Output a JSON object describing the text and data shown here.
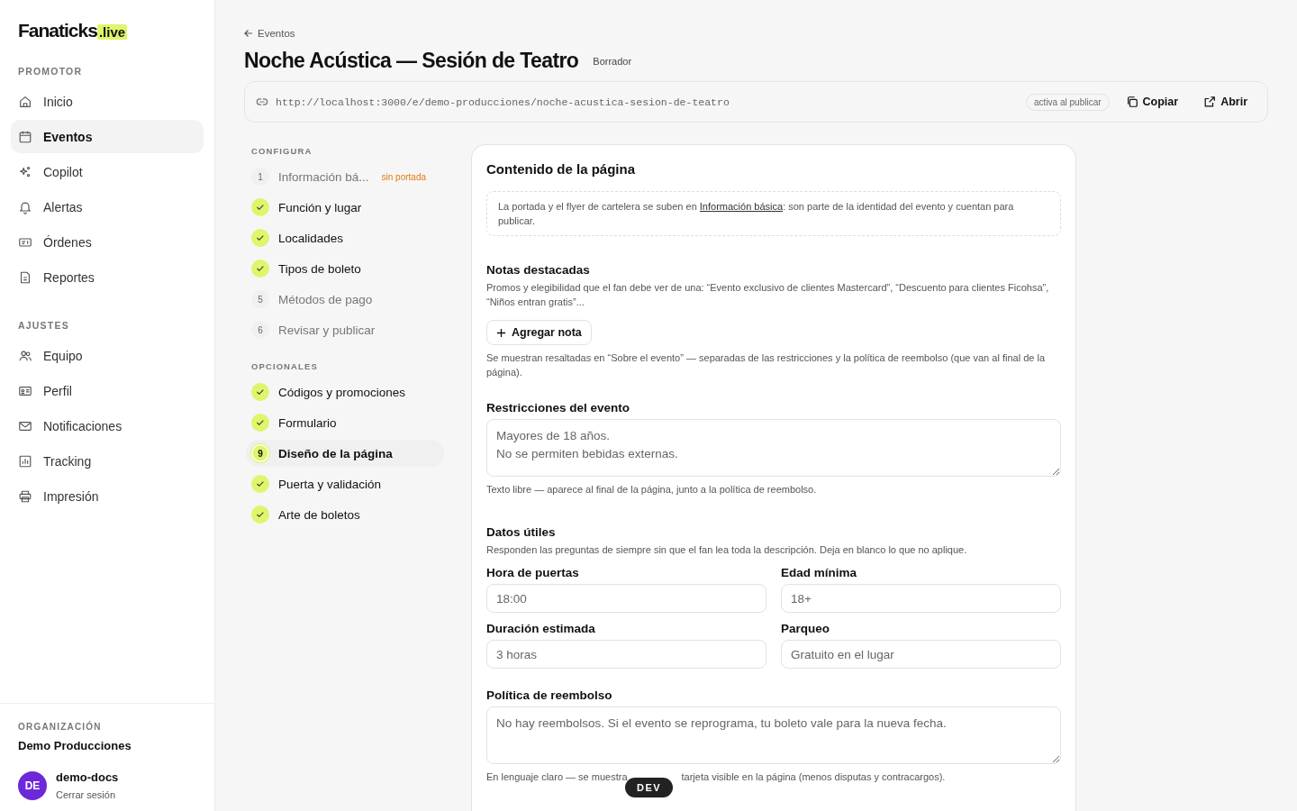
{
  "brand": {
    "name": "Fanaticks",
    "suffix": ".live"
  },
  "sidebar": {
    "sections": [
      {
        "title": "PROMOTOR",
        "items": [
          {
            "label": "Inicio",
            "selected": false
          },
          {
            "label": "Eventos",
            "selected": true
          },
          {
            "label": "Copilot",
            "selected": false
          },
          {
            "label": "Alertas",
            "selected": false
          },
          {
            "label": "Órdenes",
            "selected": false
          },
          {
            "label": "Reportes",
            "selected": false
          }
        ]
      },
      {
        "title": "AJUSTES",
        "items": [
          {
            "label": "Equipo",
            "selected": false
          },
          {
            "label": "Perfil",
            "selected": false
          },
          {
            "label": "Notificaciones",
            "selected": false
          },
          {
            "label": "Tracking",
            "selected": false
          },
          {
            "label": "Impresión",
            "selected": false
          }
        ]
      }
    ],
    "org_label": "ORGANIZACIÓN",
    "org_name": "Demo Producciones",
    "user": {
      "initials": "DE",
      "name": "demo-docs",
      "action": "Cerrar sesión"
    }
  },
  "header": {
    "back": "Eventos",
    "title": "Noche Acústica — Sesión de Teatro",
    "status": "Borrador",
    "url": "http://localhost:3000/e/demo-producciones/noche-acustica-sesion-de-teatro",
    "url_badge": "activa al publicar",
    "copy": "Copiar",
    "open": "Abrir"
  },
  "steps": [
    {
      "title": "CONFIGURA",
      "items": [
        {
          "number": "1",
          "label": "Información bá...",
          "done": false,
          "selected": false,
          "badge": "sin portada"
        },
        {
          "label": "Función y lugar",
          "done": true,
          "selected": false
        },
        {
          "label": "Localidades",
          "done": true,
          "selected": false
        },
        {
          "label": "Tipos de boleto",
          "done": true,
          "selected": false
        },
        {
          "number": "5",
          "label": "Métodos de pago",
          "done": false,
          "selected": false
        },
        {
          "number": "6",
          "label": "Revisar y publicar",
          "done": false,
          "selected": false
        }
      ]
    },
    {
      "title": "OPCIONALES",
      "items": [
        {
          "label": "Códigos y promociones",
          "done": true,
          "selected": false
        },
        {
          "label": "Formulario",
          "done": true,
          "selected": false
        },
        {
          "number": "9",
          "label": "Diseño de la página",
          "done": false,
          "selected": true
        },
        {
          "label": "Puerta y validación",
          "done": true,
          "selected": false
        },
        {
          "label": "Arte de boletos",
          "done": true,
          "selected": false
        }
      ]
    }
  ],
  "card": {
    "title": "Contenido de la página",
    "note": {
      "before": "La portada y el flyer de cartelera se suben en ",
      "link": "Información básica",
      "after": ": son parte de la identidad del evento y cuentan para publicar."
    },
    "highlights": {
      "title": "Notas destacadas",
      "description": "Promos y elegibilidad que el fan debe ver de una: “Evento exclusivo de clientes Mastercard”, “Descuento para clientes Ficohsa”, “Niños entran gratis”...",
      "button": "Agregar nota",
      "hint": "Se muestran resaltadas en “Sobre el evento” — separadas de las restricciones y la política de reembolso (que van al final de la página)."
    },
    "restrictions": {
      "title": "Restricciones del evento",
      "placeholder": "Mayores de 18 años.\nNo se permiten bebidas externas.",
      "hint": "Texto libre — aparece al final de la página, junto a la política de reembolso."
    },
    "facts": {
      "title": "Datos útiles",
      "description": "Responden las preguntas de siempre sin que el fan lea toda la descripción. Deja en blanco lo que no aplique.",
      "fields": [
        {
          "label": "Hora de puertas",
          "placeholder": "18:00"
        },
        {
          "label": "Edad mínima",
          "placeholder": "18+"
        },
        {
          "label": "Duración estimada",
          "placeholder": "3 horas"
        },
        {
          "label": "Parqueo",
          "placeholder": "Gratuito en el lugar"
        }
      ]
    },
    "refund": {
      "title": "Política de reembolso",
      "placeholder": "No hay reembolsos. Si el evento se reprograma, tu boleto vale para la nueva fecha.",
      "hint_start": "En lenguaje claro — se muestra",
      "hint_end": "tarjeta visible en la página (menos disputas y contracargos)."
    }
  },
  "dev_badge": "DEV"
}
